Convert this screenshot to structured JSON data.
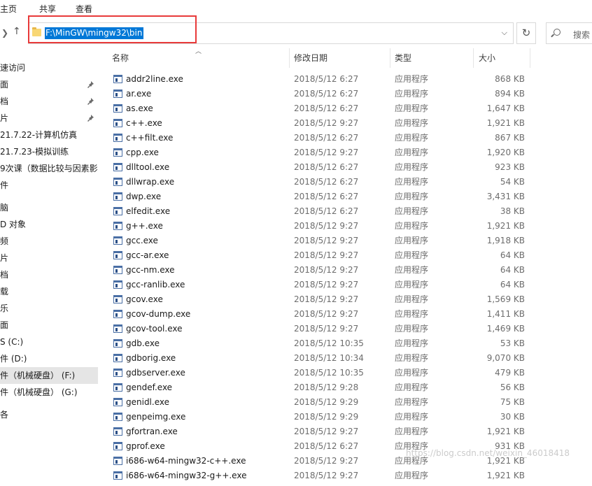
{
  "ribbon": {
    "tabs": [
      "主页",
      "共享",
      "查看"
    ]
  },
  "address": {
    "path": "F:\\MinGW\\mingw32\\bin",
    "search_placeholder": "搜索"
  },
  "sidebar": {
    "items": [
      {
        "label": "速访问",
        "pinned": false,
        "selected": false
      },
      {
        "label": "面",
        "pinned": true,
        "selected": false
      },
      {
        "label": "档",
        "pinned": true,
        "selected": false
      },
      {
        "label": "片",
        "pinned": true,
        "selected": false
      },
      {
        "label": "21.7.22-计算机仿真",
        "pinned": false,
        "selected": false
      },
      {
        "label": "21.7.23-模拟训练",
        "pinned": false,
        "selected": false
      },
      {
        "label": "9次课（数据比较与因素影",
        "pinned": false,
        "selected": false
      },
      {
        "label": "件",
        "pinned": false,
        "selected": false
      },
      {
        "label": "脑",
        "pinned": false,
        "selected": false
      },
      {
        "label": "D 对象",
        "pinned": false,
        "selected": false
      },
      {
        "label": "频",
        "pinned": false,
        "selected": false
      },
      {
        "label": "片",
        "pinned": false,
        "selected": false
      },
      {
        "label": "档",
        "pinned": false,
        "selected": false
      },
      {
        "label": "载",
        "pinned": false,
        "selected": false
      },
      {
        "label": "乐",
        "pinned": false,
        "selected": false
      },
      {
        "label": "面",
        "pinned": false,
        "selected": false
      },
      {
        "label": "S (C:)",
        "pinned": false,
        "selected": false
      },
      {
        "label": "件 (D:)",
        "pinned": false,
        "selected": false
      },
      {
        "label": "件（机械硬盘） (F:)",
        "pinned": false,
        "selected": true
      },
      {
        "label": "件（机械硬盘） (G:)",
        "pinned": false,
        "selected": false
      },
      {
        "label": "各",
        "pinned": false,
        "selected": false
      }
    ]
  },
  "columns": {
    "name": "名称",
    "date": "修改日期",
    "type": "类型",
    "size": "大小"
  },
  "files": [
    {
      "name": "addr2line.exe",
      "date": "2018/5/12 6:27",
      "type": "应用程序",
      "size": "868 KB"
    },
    {
      "name": "ar.exe",
      "date": "2018/5/12 6:27",
      "type": "应用程序",
      "size": "894 KB"
    },
    {
      "name": "as.exe",
      "date": "2018/5/12 6:27",
      "type": "应用程序",
      "size": "1,647 KB"
    },
    {
      "name": "c++.exe",
      "date": "2018/5/12 9:27",
      "type": "应用程序",
      "size": "1,921 KB"
    },
    {
      "name": "c++filt.exe",
      "date": "2018/5/12 6:27",
      "type": "应用程序",
      "size": "867 KB"
    },
    {
      "name": "cpp.exe",
      "date": "2018/5/12 9:27",
      "type": "应用程序",
      "size": "1,920 KB"
    },
    {
      "name": "dlltool.exe",
      "date": "2018/5/12 6:27",
      "type": "应用程序",
      "size": "923 KB"
    },
    {
      "name": "dllwrap.exe",
      "date": "2018/5/12 6:27",
      "type": "应用程序",
      "size": "54 KB"
    },
    {
      "name": "dwp.exe",
      "date": "2018/5/12 6:27",
      "type": "应用程序",
      "size": "3,431 KB"
    },
    {
      "name": "elfedit.exe",
      "date": "2018/5/12 6:27",
      "type": "应用程序",
      "size": "38 KB"
    },
    {
      "name": "g++.exe",
      "date": "2018/5/12 9:27",
      "type": "应用程序",
      "size": "1,921 KB"
    },
    {
      "name": "gcc.exe",
      "date": "2018/5/12 9:27",
      "type": "应用程序",
      "size": "1,918 KB"
    },
    {
      "name": "gcc-ar.exe",
      "date": "2018/5/12 9:27",
      "type": "应用程序",
      "size": "64 KB"
    },
    {
      "name": "gcc-nm.exe",
      "date": "2018/5/12 9:27",
      "type": "应用程序",
      "size": "64 KB"
    },
    {
      "name": "gcc-ranlib.exe",
      "date": "2018/5/12 9:27",
      "type": "应用程序",
      "size": "64 KB"
    },
    {
      "name": "gcov.exe",
      "date": "2018/5/12 9:27",
      "type": "应用程序",
      "size": "1,569 KB"
    },
    {
      "name": "gcov-dump.exe",
      "date": "2018/5/12 9:27",
      "type": "应用程序",
      "size": "1,411 KB"
    },
    {
      "name": "gcov-tool.exe",
      "date": "2018/5/12 9:27",
      "type": "应用程序",
      "size": "1,469 KB"
    },
    {
      "name": "gdb.exe",
      "date": "2018/5/12 10:35",
      "type": "应用程序",
      "size": "53 KB"
    },
    {
      "name": "gdborig.exe",
      "date": "2018/5/12 10:34",
      "type": "应用程序",
      "size": "9,070 KB"
    },
    {
      "name": "gdbserver.exe",
      "date": "2018/5/12 10:35",
      "type": "应用程序",
      "size": "479 KB"
    },
    {
      "name": "gendef.exe",
      "date": "2018/5/12 9:28",
      "type": "应用程序",
      "size": "56 KB"
    },
    {
      "name": "genidl.exe",
      "date": "2018/5/12 9:29",
      "type": "应用程序",
      "size": "75 KB"
    },
    {
      "name": "genpeimg.exe",
      "date": "2018/5/12 9:29",
      "type": "应用程序",
      "size": "30 KB"
    },
    {
      "name": "gfortran.exe",
      "date": "2018/5/12 9:27",
      "type": "应用程序",
      "size": "1,921 KB"
    },
    {
      "name": "gprof.exe",
      "date": "2018/5/12 6:27",
      "type": "应用程序",
      "size": "931 KB"
    },
    {
      "name": "i686-w64-mingw32-c++.exe",
      "date": "2018/5/12 9:27",
      "type": "应用程序",
      "size": "1,921 KB"
    },
    {
      "name": "i686-w64-mingw32-g++.exe",
      "date": "2018/5/12 9:27",
      "type": "应用程序",
      "size": "1,921 KB"
    }
  ],
  "watermark": "https://blog.csdn.net/weixin_46018418",
  "colors": {
    "selection": "#0078d7",
    "highlight_frame": "#e83a3a",
    "sidebar_selected": "#e5e5e5"
  }
}
